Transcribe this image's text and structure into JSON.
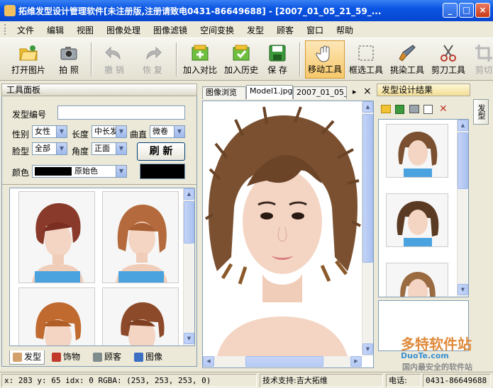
{
  "window": {
    "title": "拓维发型设计管理软件[未注册版,注册请致电0431-86649688] - [2007_01_05_21_59_...",
    "min_label": "_",
    "max_label": "□",
    "close_label": "×"
  },
  "menu": {
    "items": [
      "文件",
      "编辑",
      "视图",
      "图像处理",
      "图像滤镜",
      "空间变换",
      "发型",
      "顾客",
      "窗口",
      "帮助"
    ]
  },
  "toolbar": {
    "open": "打开图片",
    "capture": "拍 照",
    "undo": "撤 销",
    "redo": "恢 复",
    "add_compare": "加入对比",
    "add_history": "加入历史",
    "save": "保 存",
    "move": "移动工具",
    "select": "框选工具",
    "pick": "挑染工具",
    "cut": "剪刀工具",
    "crop": "剪切"
  },
  "left_panel": {
    "title": "工具面板",
    "hair_id_label": "发型编号",
    "hair_id_value": "",
    "gender_label": "性别",
    "gender_value": "女性",
    "length_label": "长度",
    "length_value": "中长发",
    "curl_label": "曲直",
    "curl_value": "微卷",
    "face_label": "脸型",
    "face_value": "全部",
    "angle_label": "角度",
    "angle_value": "正面",
    "refresh_label": "刷 新",
    "color_label": "颜色",
    "color_value": "原始色",
    "tabs": [
      "发型",
      "饰物",
      "顾客",
      "图像"
    ]
  },
  "center_panel": {
    "tabs": [
      "图像浏览",
      "Model1.jpg",
      "2007_01_05_"
    ],
    "tab_arrow": "▸",
    "close": "×"
  },
  "right_panel": {
    "title": "发型设计结果",
    "side_tab": "发型"
  },
  "status": {
    "coords": "x: 283 y: 65  idx: 0  RGBA: (253, 253, 253, 0)",
    "support": "技术支持:吉大拓维",
    "phone_label": "电话:",
    "phone": "0431-86649688"
  },
  "watermark": {
    "brand": "多特软件站",
    "domain": "DuoTe.com",
    "footer": "国内最安全的软件站"
  },
  "colors": {
    "title_bar": "#0a55e4",
    "hair_brown": "#8b5a2b",
    "skin": "#f4d5c4",
    "active_tool": "#f7c86a"
  }
}
